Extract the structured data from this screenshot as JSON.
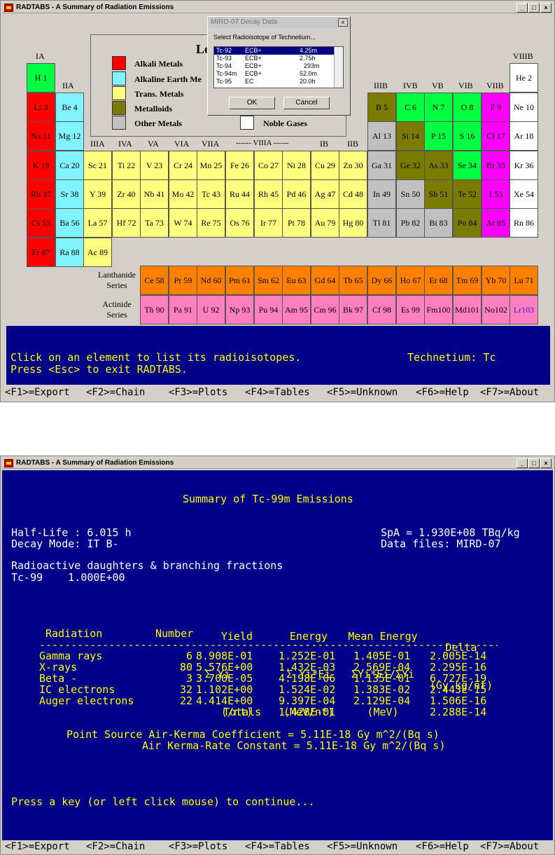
{
  "window1": {
    "title": "RADTABS - A Summary of Radiation Emissions",
    "win_buttons": [
      "_",
      "□",
      "×"
    ],
    "groups": {
      "IA": "IA",
      "IIA": "IIA",
      "IIIA": "IIIA",
      "IVA": "IVA",
      "VA": "VA",
      "VIA": "VIA",
      "VIIA": "VIIA",
      "VIIIA": "------ VIIIA ------",
      "IB": "IB",
      "IIB": "IIB",
      "IIIB": "IIIB",
      "IVB": "IVB",
      "VB": "VB",
      "VIB": "VIB",
      "VIIB": "VIIB",
      "VIIIB": "VIIIB"
    },
    "legend": {
      "title": "Le",
      "items": [
        "Alkali Metals",
        "Alkaline Earth Me",
        "Trans. Metals",
        "Metalloids",
        "Other Metals"
      ],
      "noble": "Noble Gases",
      "colors": {
        "alkali": "#ff0000",
        "alkaline": "#7ff4ff",
        "trans": "#ffff7f",
        "metalloid": "#7b7b00",
        "other": "#c0c0c0",
        "noble": "#ffffff",
        "nonmetal": "#00ff40",
        "halogen": "#ff00ff",
        "lanthanide": "#ff7f00",
        "actinide": "#ff7fbf"
      }
    },
    "series_labels": {
      "lanthanide": [
        "Lanthanide",
        "Series"
      ],
      "actinide": [
        "Actinide",
        "Series"
      ]
    },
    "dialog": {
      "title": "MIRD-07 Decay Data",
      "close": "×",
      "prompt": "Select Radioisotope of Technetium...",
      "items": [
        {
          "iso": "Tc-92",
          "mode": "ECB+",
          "hl": "4.25m",
          "selected": true
        },
        {
          "iso": "Tc-93",
          "mode": "ECB+",
          "hl": "2.75h",
          "selected": false
        },
        {
          "iso": "Tc-94",
          "mode": "ECB+",
          "hl": "293m",
          "selected": false
        },
        {
          "iso": "Tc-94m",
          "mode": "ECB+",
          "hl": "52.0m",
          "selected": false
        },
        {
          "iso": "Tc-95",
          "mode": "EC",
          "hl": "20.0h",
          "selected": false
        }
      ],
      "ok": "OK",
      "cancel": "Cancel"
    },
    "status1": "Click on an element to list its radioisotopes.",
    "status2": "Press <Esc> to exit RADTABS.",
    "selected_element": "Technetium: Tc"
  },
  "elements": {
    "H": "H  1",
    "He": "He  2",
    "Li": "Li  3",
    "Be": "Be  4",
    "B": "B  5",
    "C": "C  6",
    "N": "N  7",
    "O": "O  8",
    "F": "F  9",
    "Ne": "Ne 10",
    "Na": "Na 11",
    "Mg": "Mg 12",
    "Al": "Al 13",
    "Si": "Si 14",
    "P": "P 15",
    "S": "S  16",
    "Cl": "Cl 17",
    "Ar": "Ar 18",
    "K": "K  19",
    "Ca": "Ca 20",
    "Sc": "Sc 21",
    "Ti": "Ti 22",
    "V": "V  23",
    "Cr": "Cr 24",
    "Mn": "Mn 25",
    "Fe": "Fe 26",
    "Co": "Co 27",
    "Ni": "Ni 28",
    "Cu": "Cu 29",
    "Zn": "Zn 30",
    "Ga": "Ga 31",
    "Ge": "Ge 32",
    "As": "As 33",
    "Se": "Se 34",
    "Br": "Br 35",
    "Kr": "Kr 36",
    "Rb": "Rb 37",
    "Sr": "Sr 38",
    "Y": "Y  39",
    "Zr": "Zr 40",
    "Nb": "Nb 41",
    "Mo": "Mo 42",
    "Tc": "Tc 43",
    "Ru": "Ru 44",
    "Rh": "Rh 45",
    "Pd": "Pd 46",
    "Ag": "Ag 47",
    "Cd": "Cd 48",
    "In": "In 49",
    "Sn": "Sn 50",
    "Sb": "Sb 51",
    "Te": "Te 52",
    "I": "I  53",
    "Xe": "Xe 54",
    "Cs": "Cs 55",
    "Ba": "Ba 56",
    "La": "La 57",
    "Hf": "Hf  72",
    "Ta": "Ta 73",
    "W": "W  74",
    "Re": "Re 75",
    "Os": "Os 76",
    "Ir": "Ir 77",
    "Pt": "Pt 78",
    "Au": "Au 79",
    "Hg": "Hg 80",
    "Tl": "Tl  81",
    "Pb": "Pb 82",
    "Bi": "Bi  83",
    "Po": "Po 84",
    "At": "At 85",
    "Rn": "Rn  86",
    "Fr": "Fr  87",
    "Ra": "Ra 88",
    "Ac": "Ac 89",
    "Ce": "Ce 58",
    "Pr": "Pr 59",
    "Nd": "Nd 60",
    "Pm": "Pm 61",
    "Sm": "Sm 62",
    "Eu": "Eu 63",
    "Gd": "Gd 64",
    "Tb": "Tb 65",
    "Dy": "Dy 66",
    "Ho": "Ho 67",
    "Er": "Er 68",
    "Tm": "Tm 69",
    "Yb": "Yb 70",
    "Lu": "Lu  71",
    "Th": "Th  90",
    "Pa": "Pa 91",
    "U": "U  92",
    "Np": "Np 93",
    "Pu": "Pu 94",
    "Am": "Am 95",
    "Cm": "Cm 96",
    "Bk": "Bk 97",
    "Cf": "Cf 98",
    "Es": "Es 99",
    "Fm": "Fm100",
    "Md": "Md101",
    "No": "No102",
    "Lr": "Lr103"
  },
  "fkeys": [
    "<F1>=Export",
    "<F2>=Chain",
    "<F3>=Plots",
    "<F4>=Tables",
    "<F5>=Unknown",
    "<F6>=Help",
    "<F7>=About"
  ],
  "window2": {
    "title": "RADTABS - A Summary of Radiation Emissions",
    "heading": "Summary of Tc-99m Emissions",
    "halflife": "Half-Life : 6.015 h",
    "decay_mode": "Decay Mode: IT B-",
    "spa": "SpA = 1.930E+08 TBq/kg",
    "data_files": "Data files: MIRD-07",
    "daughters_title": "Radioactive daughters & branching fractions",
    "daughter": "Tc-99    1.000E+00",
    "headers": {
      "yield": [
        "Yield",
        "Σ Yi",
        "(/nt)"
      ],
      "energy": [
        "Energy",
        "Σ Yi*Ei",
        "(MeV/nt)"
      ],
      "mean": [
        "Mean Energy",
        "ΣYi*Ei/ΣYi",
        "(MeV)"
      ],
      "delta": [
        "Delta",
        "(Gy kg/nt)"
      ],
      "radiation": "Radiation",
      "number": "Number"
    },
    "divider": "--------------------------------------------------------------------------------",
    "rows": [
      {
        "name": "Gamma rays",
        "number": "6",
        "yield": "8.908E-01",
        "energy": "1.252E-01",
        "mean": "1.405E-01",
        "delta": "2.005E-14"
      },
      {
        "name": "X-rays",
        "number": "80",
        "yield": "5.576E+00",
        "energy": "1.432E-03",
        "mean": "2.569E-04",
        "delta": "2.295E-16"
      },
      {
        "name": "Beta -",
        "number": "3",
        "yield": "3.700E-05",
        "energy": "4.198E-06",
        "mean": "1.135E-01",
        "delta": "6.727E-19"
      },
      {
        "name": "IC electrons",
        "number": "32",
        "yield": "1.102E+00",
        "energy": "1.524E-02",
        "mean": "1.383E-02",
        "delta": "2.443E-15"
      },
      {
        "name": "Auger electrons",
        "number": "22",
        "yield": "4.414E+00",
        "energy": "9.397E-04",
        "mean": "2.129E-04",
        "delta": "1.506E-16"
      }
    ],
    "totals": {
      "label": "Totals",
      "energy": "1.428E-01",
      "delta": "2.288E-14"
    },
    "kerma1": "Point Source Air-Kerma Coefficient = 5.11E-18 Gy m^2/(Bq s)",
    "kerma2": "Air Kerma-Rate Constant = 5.11E-18 Gy m^2/(Bq s)",
    "continue": "Press a key (or left click mouse) to continue..."
  }
}
